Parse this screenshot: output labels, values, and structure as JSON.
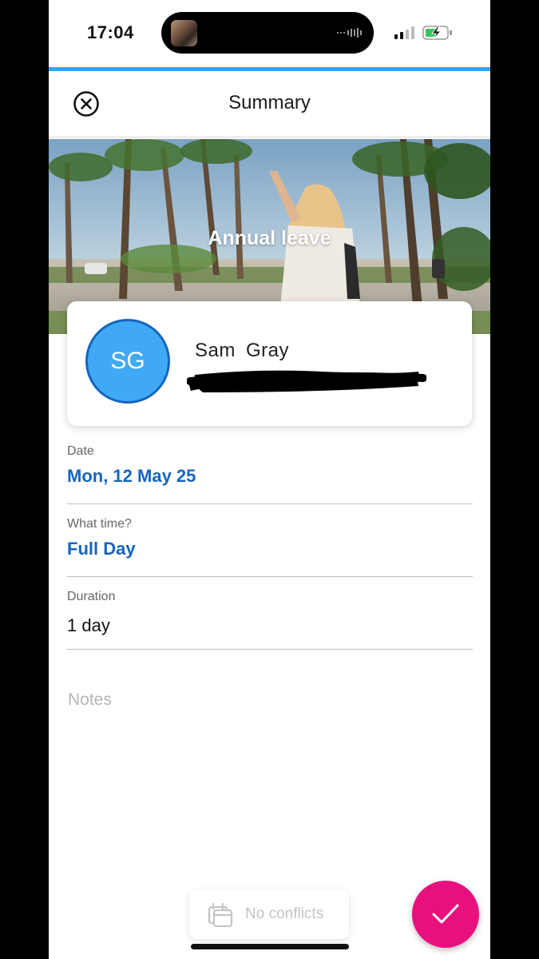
{
  "status_bar": {
    "time": "17:04"
  },
  "header": {
    "title": "Summary",
    "close_icon": "close-circle-icon"
  },
  "hero": {
    "title": "Annual leave"
  },
  "profile": {
    "initials": "SG",
    "name": "Sam  Gray"
  },
  "fields": [
    {
      "label": "Date",
      "value": "Mon, 12 May 25"
    },
    {
      "label": "What time?",
      "value": "Full Day"
    },
    {
      "label": "Duration",
      "value": "1 day"
    }
  ],
  "notes": {
    "placeholder": "Notes"
  },
  "footer": {
    "conflicts_label": "No conflicts",
    "conflicts_icon": "calendar-stack-icon",
    "confirm_icon": "checkmark-icon"
  },
  "colors": {
    "accent_blue": "#1565c0",
    "progress_blue": "#3aa3e8",
    "avatar_fill": "#3fa9f5",
    "confirm_pink": "#e8107f"
  }
}
